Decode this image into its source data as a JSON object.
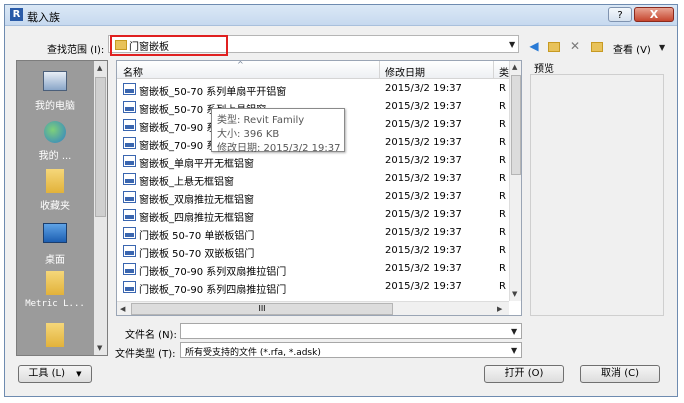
{
  "window": {
    "title": "载入族",
    "help_label": "?",
    "close_label": "X"
  },
  "lookin": {
    "label": "查找范围 (I):",
    "value": "门窗嵌板"
  },
  "toolbar": {
    "view_label": "查看 (V)"
  },
  "places": [
    {
      "label": "我的电脑",
      "icon": "computer-icon"
    },
    {
      "label": "我的 ...",
      "icon": "globe-icon"
    },
    {
      "label": "收藏夹",
      "icon": "favorites-folder-icon"
    },
    {
      "label": "桌面",
      "icon": "desktop-icon"
    },
    {
      "label": "Metric L...",
      "icon": "folder-icon"
    }
  ],
  "columns": {
    "name": "名称",
    "date": "修改日期",
    "type": "类"
  },
  "files": [
    {
      "name": "窗嵌板_50-70 系列单扇平开铝窗",
      "date": "2015/3/2 19:37",
      "type": "R"
    },
    {
      "name": "窗嵌板_50-70 系列上悬铝窗",
      "date": "2015/3/2 19:37",
      "type": "R"
    },
    {
      "name": "窗嵌板_70-90 系",
      "date": "2015/3/2 19:37",
      "type": "R"
    },
    {
      "name": "窗嵌板_70-90 系",
      "date": "2015/3/2 19:37",
      "type": "R"
    },
    {
      "name": "窗嵌板_单扇平开无框铝窗",
      "date": "2015/3/2 19:37",
      "type": "R"
    },
    {
      "name": "窗嵌板_上悬无框铝窗",
      "date": "2015/3/2 19:37",
      "type": "R"
    },
    {
      "name": "窗嵌板_双扇推拉无框铝窗",
      "date": "2015/3/2 19:37",
      "type": "R"
    },
    {
      "name": "窗嵌板_四扇推拉无框铝窗",
      "date": "2015/3/2 19:37",
      "type": "R"
    },
    {
      "name": "门嵌板 50-70 单嵌板铝门",
      "date": "2015/3/2 19:37",
      "type": "R"
    },
    {
      "name": "门嵌板 50-70 双嵌板铝门",
      "date": "2015/3/2 19:37",
      "type": "R"
    },
    {
      "name": "门嵌板_70-90 系列双扇推拉铝门",
      "date": "2015/3/2 19:37",
      "type": "R"
    },
    {
      "name": "门嵌板_70-90 系列四扇推拉铝门",
      "date": "2015/3/2 19:37",
      "type": "R"
    }
  ],
  "tooltip": {
    "type": "类型: Revit Family",
    "size": "大小: 396 KB",
    "modified": "修改日期: 2015/3/2 19:37"
  },
  "preview": {
    "label": "预览"
  },
  "filename": {
    "label": "文件名 (N):",
    "value": ""
  },
  "filetype": {
    "label": "文件类型 (T):",
    "value": "所有受支持的文件 (*.rfa, *.adsk)"
  },
  "buttons": {
    "tools": "工具 (L)",
    "open": "打开 (O)",
    "cancel": "取消 (C)"
  }
}
